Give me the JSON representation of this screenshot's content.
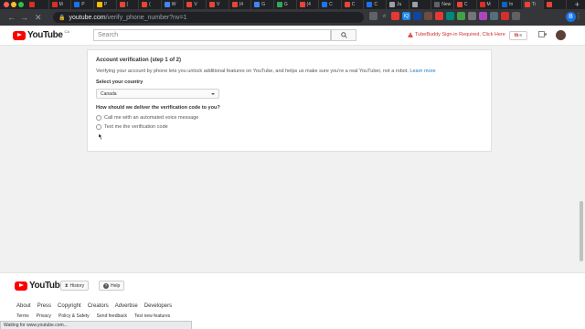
{
  "browser": {
    "tabs": [
      {
        "label": "",
        "color": "#d93025"
      },
      {
        "label": "M",
        "color": "#d93025"
      },
      {
        "label": "P",
        "color": "#1a73e8"
      },
      {
        "label": "P",
        "color": "#fbbc04"
      },
      {
        "label": "(",
        "color": "#ea4335"
      },
      {
        "label": "(",
        "color": "#ea4335"
      },
      {
        "label": "W",
        "color": "#4285f4"
      },
      {
        "label": "V",
        "color": "#ea4335"
      },
      {
        "label": "V",
        "color": "#ea4335"
      },
      {
        "label": "(4",
        "color": "#ea4335"
      },
      {
        "label": "G",
        "color": "#4285f4"
      },
      {
        "label": "G",
        "color": "#34a853"
      },
      {
        "label": "(4",
        "color": "#ea4335"
      },
      {
        "label": "C",
        "color": "#1877f2"
      },
      {
        "label": "C",
        "color": "#ea4335"
      },
      {
        "label": "C",
        "color": "#1a73e8"
      },
      {
        "label": "Ju",
        "color": "#9aa0a6"
      },
      {
        "label": "",
        "color": "#9aa0a6"
      },
      {
        "label": "New",
        "color": "#5f6368"
      },
      {
        "label": "C",
        "color": "#ea4335"
      },
      {
        "label": "M",
        "color": "#d93025"
      },
      {
        "label": "In",
        "color": "#0a66c2"
      },
      {
        "label": "Ti",
        "color": "#ea4335"
      },
      {
        "label": "",
        "color": "#ea4335"
      }
    ],
    "active_tab_index": 22,
    "url_host": "youtube.com",
    "url_path": "/verify_phone_number?nv=1",
    "profile_initial": "B",
    "extensions": [
      {
        "label": "",
        "color": "#5f6368"
      },
      {
        "label": "☆",
        "color": "#35363a"
      },
      {
        "label": "",
        "color": "#e53935"
      },
      {
        "label": "IQ",
        "color": "#1e88e5"
      },
      {
        "label": "",
        "color": "#0d47a1"
      },
      {
        "label": "",
        "color": "#6d4c41"
      },
      {
        "label": "",
        "color": "#e53935"
      },
      {
        "label": "",
        "color": "#00897b"
      },
      {
        "label": "",
        "color": "#43a047"
      },
      {
        "label": "",
        "color": "#757575"
      },
      {
        "label": "",
        "color": "#ab47bc"
      },
      {
        "label": "",
        "color": "#546e7a"
      },
      {
        "label": "",
        "color": "#d32f2f"
      },
      {
        "label": "",
        "color": "#616161"
      }
    ]
  },
  "header": {
    "logo_text": "YouTube",
    "country_code": "CA",
    "search_placeholder": "Search",
    "tubebuddy_warning": "TubeBuddy Sign-in Required, Click Here",
    "tubebuddy_button": "tb"
  },
  "verification": {
    "title": "Account verification (step 1 of 2)",
    "description": "Verifying your account by phone lets you unlock additional features on YouTube, and helps us make sure you're a real YouTuber, not a robot.",
    "learn_more": "Learn more",
    "country_label": "Select your country",
    "country_value": "Canada",
    "delivery_label": "How should we deliver the verification code to you?",
    "options": [
      "Call me with an automated voice message",
      "Text me the verification code"
    ]
  },
  "footer": {
    "logo_text": "YouTube",
    "history_button": "History",
    "help_button": "Help",
    "links_primary": [
      "About",
      "Press",
      "Copyright",
      "Creators",
      "Advertise",
      "Developers"
    ],
    "links_secondary": [
      "Terms",
      "Privacy",
      "Policy & Safety",
      "Send feedback",
      "Test new features"
    ]
  },
  "status_bar": "Waiting for www.youtube.com..."
}
